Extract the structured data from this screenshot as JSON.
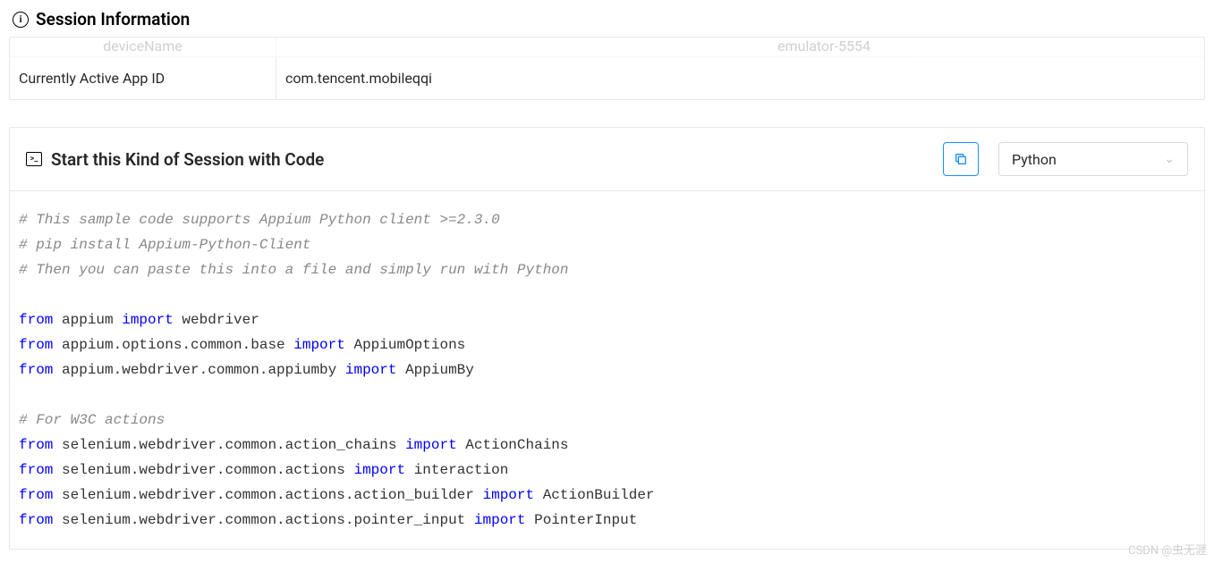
{
  "session_info": {
    "title": "Session Information",
    "rows": [
      {
        "label": "deviceName",
        "value": "emulator-5554",
        "faded": true
      },
      {
        "label": "Currently Active App ID",
        "value": "com.tencent.mobileqqi",
        "faded": false
      }
    ]
  },
  "code_section": {
    "title": "Start this Kind of Session with Code",
    "language": "Python",
    "code_lines": [
      {
        "type": "comment",
        "text": "# This sample code supports Appium Python client >=2.3.0"
      },
      {
        "type": "comment",
        "text": "# pip install Appium-Python-Client"
      },
      {
        "type": "comment",
        "text": "# Then you can paste this into a file and simply run with Python"
      },
      {
        "type": "blank",
        "text": ""
      },
      {
        "type": "import",
        "parts": [
          {
            "k": "from",
            "t": " appium "
          },
          {
            "k": "import",
            "t": " webdriver"
          }
        ]
      },
      {
        "type": "import",
        "parts": [
          {
            "k": "from",
            "t": " appium.options.common.base "
          },
          {
            "k": "import",
            "t": " AppiumOptions"
          }
        ]
      },
      {
        "type": "import",
        "parts": [
          {
            "k": "from",
            "t": " appium.webdriver.common.appiumby "
          },
          {
            "k": "import",
            "t": " AppiumBy"
          }
        ]
      },
      {
        "type": "blank",
        "text": ""
      },
      {
        "type": "comment",
        "text": "# For W3C actions"
      },
      {
        "type": "import",
        "parts": [
          {
            "k": "from",
            "t": " selenium.webdriver.common.action_chains "
          },
          {
            "k": "import",
            "t": " ActionChains"
          }
        ]
      },
      {
        "type": "import",
        "parts": [
          {
            "k": "from",
            "t": " selenium.webdriver.common.actions "
          },
          {
            "k": "import",
            "t": " interaction"
          }
        ]
      },
      {
        "type": "import",
        "parts": [
          {
            "k": "from",
            "t": " selenium.webdriver.common.actions.action_builder "
          },
          {
            "k": "import",
            "t": " ActionBuilder"
          }
        ]
      },
      {
        "type": "import",
        "parts": [
          {
            "k": "from",
            "t": " selenium.webdriver.common.actions.pointer_input "
          },
          {
            "k": "import",
            "t": " PointerInput"
          }
        ]
      }
    ]
  },
  "watermark": "CSDN @虫无涯"
}
